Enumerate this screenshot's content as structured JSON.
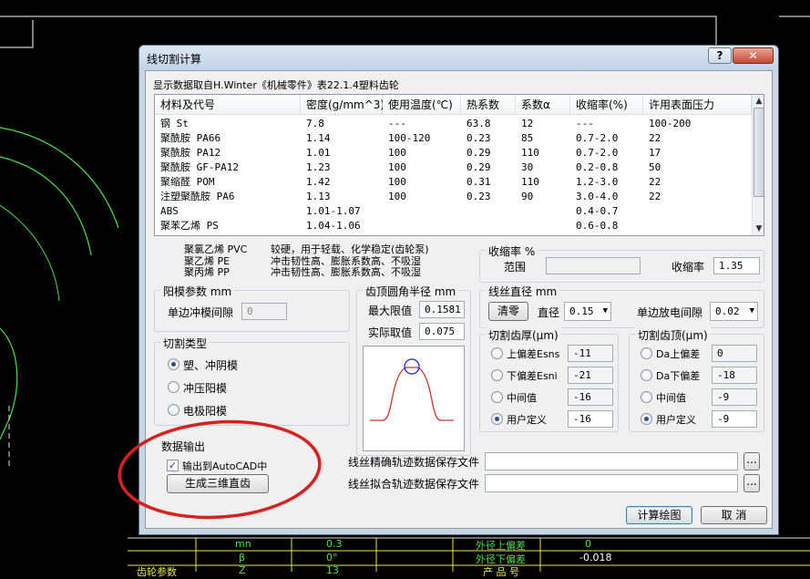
{
  "dialog": {
    "title": "线切割计算",
    "help_label": "?",
    "close_label": "✕"
  },
  "source_note": "显示数据取自H.Winter《机械零件》表22.1.4塑料齿轮",
  "table": {
    "headers": [
      "材料及代号",
      "密度(g/mm^3)",
      "使用温度(℃)",
      "热系数",
      "系数α",
      "收缩率(%)",
      "许用表面压力"
    ],
    "rows": [
      [
        "钢 St",
        "7.8",
        "---",
        "63.8",
        "12",
        "---",
        "100-200"
      ],
      [
        "聚酰胺 PA66",
        "1.14",
        "100-120",
        "0.23",
        "85",
        "0.7-2.0",
        "22"
      ],
      [
        "聚酰胺 PA12",
        "1.01",
        "100",
        "0.29",
        "110",
        "0.7-2.0",
        "17"
      ],
      [
        "聚酰胺 GF-PA12",
        "1.23",
        "100",
        "0.29",
        "30",
        "0.2-0.8",
        "50"
      ],
      [
        "聚缩醛 POM",
        "1.42",
        "100",
        "0.31",
        "110",
        "1.2-3.0",
        "22"
      ],
      [
        "注塑聚酰胺 PA6",
        "1.13",
        "100",
        "0.23",
        "90",
        "3.0-4.0",
        "22"
      ],
      [
        "ABS",
        "1.01-1.07",
        "",
        "",
        "",
        "0.4-0.7",
        ""
      ],
      [
        "聚苯乙烯 PS",
        "1.04-1.06",
        "",
        "",
        "",
        "0.6-0.8",
        ""
      ]
    ]
  },
  "notes": {
    "lines": [
      [
        "聚氯乙烯 PVC",
        "较硬，用于轻载、化学稳定(齿轮泵)"
      ],
      [
        "聚乙烯 PE",
        "冲击韧性高、膨胀系数高、不吸湿"
      ],
      [
        "聚丙烯 PP",
        "冲击韧性高、膨胀系数高、不吸湿"
      ]
    ]
  },
  "shrink": {
    "title": "收缩率 %",
    "range_label": "范围",
    "rate_label": "收缩率",
    "rate_value": "1.35"
  },
  "mold": {
    "title": "阳模参数 mm",
    "gap_label": "单边冲模间隙",
    "gap_value": "0"
  },
  "tip": {
    "title": "齿顶圆角半径 mm",
    "max_label": "最大限值",
    "max_value": "0.1581",
    "actual_label": "实际取值",
    "actual_value": "0.075"
  },
  "wire": {
    "title": "线丝直径 mm",
    "clear_label": "清零",
    "diameter_label": "直径",
    "diameter_value": "0.15",
    "gap_label": "单边放电间隙",
    "gap_value": "0.02"
  },
  "cut_type": {
    "title": "切割类型",
    "options": [
      "塑、冲阴模",
      "冲压阳模",
      "电极阳模"
    ],
    "selected": 0
  },
  "thickness": {
    "title": "切割齿厚(μm)",
    "options": [
      "上偏差Esns",
      "下偏差Esni",
      "中间值",
      "用户定义"
    ],
    "values": [
      "-11",
      "-21",
      "-16",
      "-16"
    ],
    "selected": 3
  },
  "top": {
    "title": "切割齿顶(μm)",
    "options": [
      "Da上偏差",
      "Da下偏差",
      "中间值",
      "用户定义"
    ],
    "values": [
      "0",
      "-18",
      "-9",
      "-9"
    ],
    "selected": 3
  },
  "output": {
    "title": "数据输出",
    "autocad_label": "输出到AutoCAD中",
    "autocad_checked": true,
    "gen3d_label": "生成三维直齿",
    "precise_label": "线丝精确轨迹数据保存文件",
    "fit_label": "线丝拟合轨迹数据保存文件",
    "browse_label": "..."
  },
  "actions": {
    "compute_label": "计算绘图",
    "cancel_label": "取 消"
  },
  "cad_background": {
    "row1": [
      "mn",
      "0.3",
      "外径上偏差",
      "0"
    ],
    "row2": [
      "β",
      "0°",
      "外径下偏差",
      "-0.018"
    ],
    "row3": [
      "齿轮参数",
      "Z",
      "13",
      "产 品 号"
    ]
  },
  "colors": {
    "cad_green": "#4ee04e",
    "cad_yellow": "#e8e84a",
    "annotation_red": "#d8211c",
    "profile_red": "#c0392b",
    "profile_circle": "#1e1ee0"
  }
}
